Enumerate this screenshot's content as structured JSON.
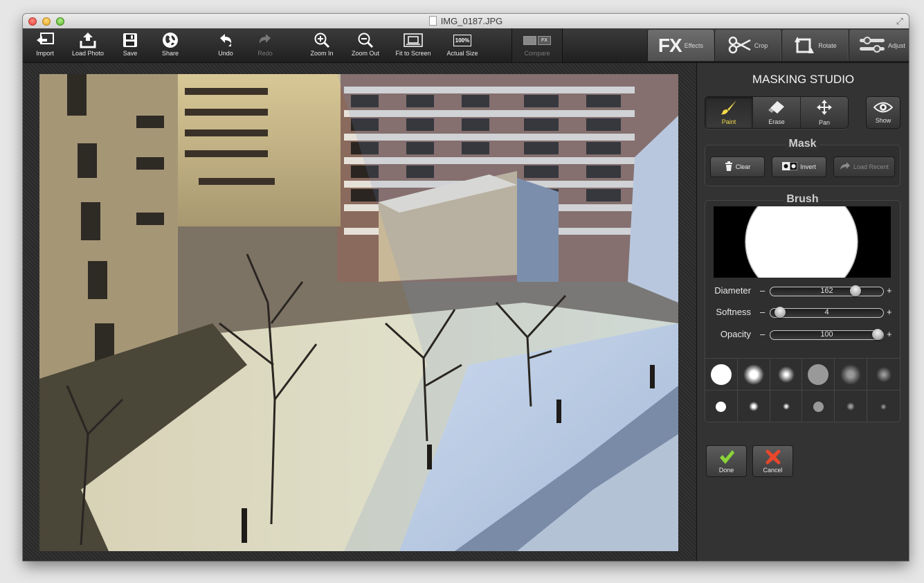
{
  "window": {
    "title": "IMG_0187.JPG"
  },
  "toolbar": {
    "import": "Import",
    "load_photo": "Load Photo",
    "save": "Save",
    "share": "Share",
    "undo": "Undo",
    "redo": "Redo",
    "zoom_in": "Zoom In",
    "zoom_out": "Zoom Out",
    "fit_to_screen": "Fit to Screen",
    "actual_size": "Actual Size",
    "actual_size_icon_text": "100%",
    "compare": "Compare",
    "compare_icon_text": "FX"
  },
  "tabs": [
    {
      "big": "FX",
      "label": "Effects",
      "active": true
    },
    {
      "label": "Crop"
    },
    {
      "label": "Rotate"
    },
    {
      "label": "Adjust"
    }
  ],
  "panel": {
    "title": "MASKING STUDIO",
    "tools": {
      "paint": "Paint",
      "erase": "Erase",
      "pan": "Pan",
      "show": "Show",
      "active": "paint",
      "active_color": "#f2d94a"
    },
    "mask": {
      "title": "Mask",
      "clear": "Clear",
      "invert": "Invert",
      "load_recent": "Load Recent"
    },
    "brush": {
      "title": "Brush",
      "diameter": {
        "label": "Diameter",
        "value": "162",
        "level": 0.78
      },
      "softness": {
        "label": "Softness",
        "value": "4",
        "level": 0.04
      },
      "opacity": {
        "label": "Opacity",
        "value": "100",
        "level": 1.0
      },
      "minus": "–",
      "plus": "+"
    },
    "done": "Done",
    "cancel": "Cancel",
    "done_color": "#8ad43a",
    "cancel_color": "#e8472c"
  }
}
